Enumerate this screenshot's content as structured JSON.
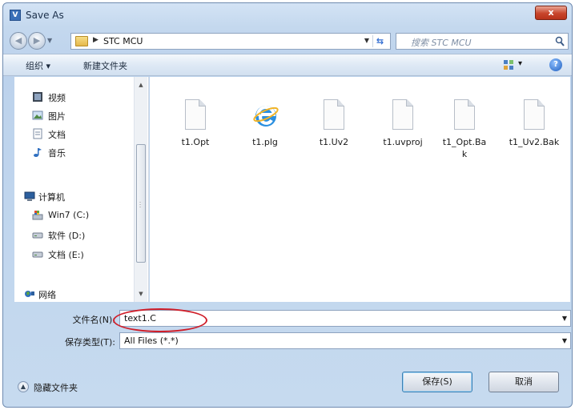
{
  "window": {
    "title": "Save As",
    "app_icon_letter": "V",
    "close_label": "x"
  },
  "address": {
    "path": "STC MCU",
    "search_placeholder": "搜索 STC MCU"
  },
  "toolbar": {
    "organize": "组织 ▾",
    "new_folder": "新建文件夹",
    "view_arrow": "▾",
    "help": "?"
  },
  "nav": {
    "items": [
      {
        "label": "视频",
        "icon": "video-icon"
      },
      {
        "label": "图片",
        "icon": "picture-icon"
      },
      {
        "label": "文档",
        "icon": "document-icon"
      },
      {
        "label": "音乐",
        "icon": "music-icon"
      },
      {
        "label": "计算机",
        "icon": "computer-icon"
      },
      {
        "label": "Win7 (C:)",
        "icon": "system-drive-icon"
      },
      {
        "label": "软件 (D:)",
        "icon": "drive-icon"
      },
      {
        "label": "文档 (E:)",
        "icon": "drive-icon"
      },
      {
        "label": "网络",
        "icon": "network-icon"
      }
    ]
  },
  "files": [
    {
      "name": "t1.Opt",
      "icon": "file-icon"
    },
    {
      "name": "t1.plg",
      "icon": "ie-file-icon"
    },
    {
      "name": "t1.Uv2",
      "icon": "file-icon"
    },
    {
      "name": "t1.uvproj",
      "icon": "file-icon"
    },
    {
      "name": "t1_Opt.Bak",
      "icon": "file-icon"
    },
    {
      "name": "t1_Uv2.Bak",
      "icon": "file-icon"
    }
  ],
  "form": {
    "filename_label": "文件名(N):",
    "filename_value": "text1.C",
    "filetype_label": "保存类型(T):",
    "filetype_value": "All Files (*.*)"
  },
  "footer": {
    "hide_folders": "隐藏文件夹",
    "save": "保存(S)",
    "cancel": "取消"
  },
  "colors": {
    "highlight": "#d01f2a",
    "frame": "#bcd2ec"
  }
}
